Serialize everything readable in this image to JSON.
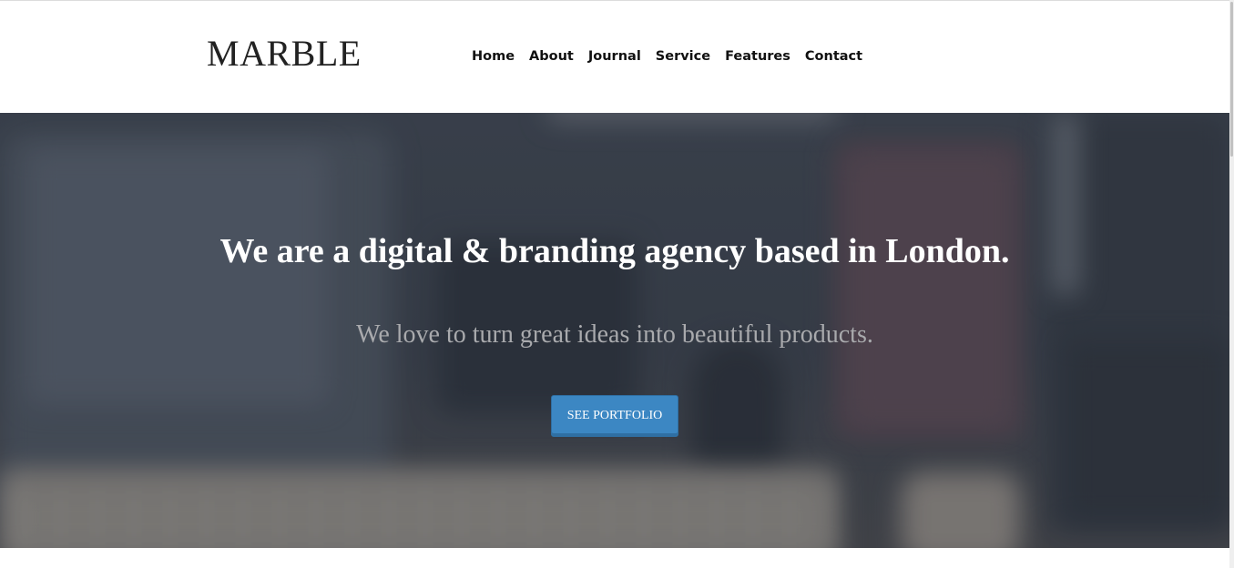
{
  "header": {
    "logo": "MARBLE",
    "nav": [
      "Home",
      "About",
      "Journal",
      "Service",
      "Features",
      "Contact"
    ]
  },
  "hero": {
    "title": "We are a digital & branding agency based in London.",
    "subtitle": "We love to turn great ideas into beautiful products.",
    "cta_label": "SEE PORTFOLIO"
  },
  "colors": {
    "accent": "#3c87c3",
    "hero_text": "#ffffff",
    "hero_subtext": "#a9aaad"
  }
}
